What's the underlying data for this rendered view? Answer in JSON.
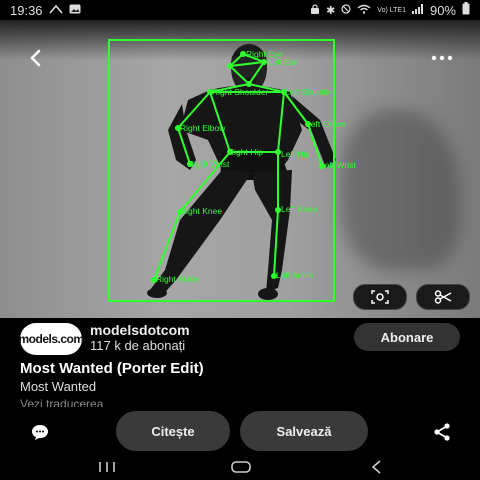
{
  "status_bar": {
    "time": "19:36",
    "network": "Vo) LTE1",
    "battery": "90%"
  },
  "pose_labels": {
    "right_eye": "Right Eye",
    "left_ear": "Left Ear",
    "right_shoulder": "Right Shoulder",
    "left_shoulder": "Left Shoulder",
    "right_elbow": "Right Elbow",
    "left_elbow": "Left Elbow",
    "right_hip": "Right Hip",
    "left_hip": "Left Hip",
    "right_wrist": "Right Wrist",
    "left_wrist": "Left Wrist",
    "right_knee": "Right Knee",
    "left_knee": "Left Knee",
    "right_ankle": "Right Ankle",
    "left_ankle": "Left Ankle"
  },
  "channel": {
    "avatar_text": "models.com",
    "name": "modelsdotcom",
    "subscribers": "117 k de abonați",
    "subscribe_label": "Abonare"
  },
  "video": {
    "title": "Most Wanted (Porter Edit)",
    "subtitle": "Most Wanted",
    "translate_label": "Vezi traducerea"
  },
  "actions": {
    "read_label": "Citește",
    "save_label": "Salvează"
  },
  "icons": {
    "back": "back-arrow-icon",
    "more": "more-options-icon",
    "lens": "visual-search-icon",
    "scissors": "scissors-icon",
    "comment": "comment-icon",
    "share": "share-icon"
  },
  "colors": {
    "pose_overlay": "#30ff30",
    "background": "#000000",
    "button": "#3a3a3a"
  }
}
